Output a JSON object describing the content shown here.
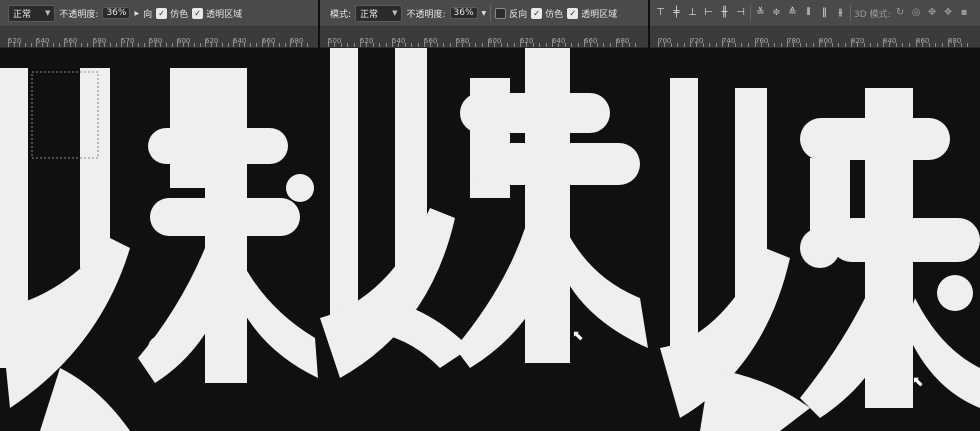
{
  "panel1": {
    "mode_value": "正常",
    "opacity_label": "不透明度:",
    "opacity_value": "36%",
    "reverse_label_partial": "向",
    "dither_label": "仿色",
    "transparency_label": "透明区域",
    "ruler_labels": [
      "520",
      "540",
      "560",
      "580",
      "570",
      "580",
      "600",
      "620",
      "640",
      "660",
      "680"
    ]
  },
  "panel2": {
    "mode_label": "模式:",
    "mode_value": "正常",
    "opacity_label": "不透明度:",
    "opacity_value": "36%",
    "reverse_label": "反向",
    "dither_label": "仿色",
    "transparency_label": "透明区域",
    "ruler_labels": [
      "500",
      "520",
      "540",
      "560",
      "580",
      "600",
      "620",
      "640",
      "660",
      "680"
    ]
  },
  "panel3": {
    "mode_3d_label": "3D 模式:",
    "ruler_labels": [
      "700",
      "720",
      "740",
      "760",
      "780",
      "800",
      "820",
      "840",
      "860",
      "880"
    ]
  },
  "colors": {
    "toolbar": "#4a4a4a",
    "ruler": "#3b3b3b",
    "canvas": "#101010",
    "glyph": "#efefef"
  },
  "icons": [
    "align-top-icon",
    "align-vcenter-icon",
    "align-bottom-icon",
    "align-left-icon",
    "align-hcenter-icon",
    "align-right-icon",
    "distribute-top-icon",
    "distribute-vcenter-icon",
    "distribute-bottom-icon",
    "distribute-left-icon",
    "distribute-hcenter-icon",
    "distribute-right-icon",
    "3d-rotate-icon",
    "3d-roll-icon",
    "3d-drag-icon",
    "3d-slide-icon",
    "3d-scale-icon"
  ]
}
